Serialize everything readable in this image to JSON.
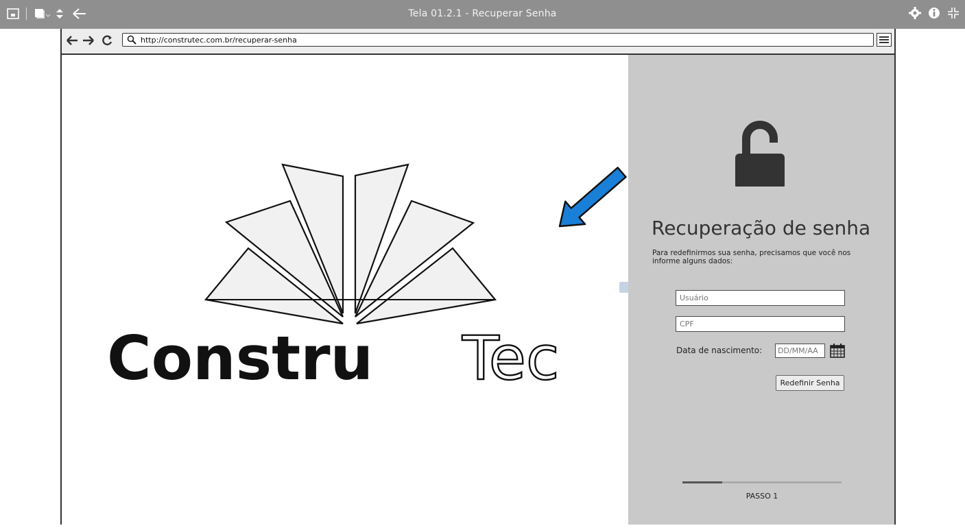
{
  "window": {
    "title": "Tela 01.2.1 - Recuperar Senha"
  },
  "browser": {
    "url": "http://construtec.com.br/recuperar-senha"
  },
  "logo": {
    "text_dark": "Constru",
    "text_light": "Tec"
  },
  "panel": {
    "heading": "Recuperação de senha",
    "description": "Para redefinirmos sua senha, precisamos que você nos informe alguns dados:",
    "username_placeholder": "Usuário",
    "cpf_placeholder": "CPF",
    "dob_label": "Data de nascimento:",
    "dob_placeholder": "DD/MM/AA",
    "submit_label": "Redefinir Senha",
    "progress_fraction": 0.25,
    "step_label": "PASSO 1"
  },
  "colors": {
    "appbar": "#8f8f8f",
    "panel": "#c9c9c9",
    "arrow": "#1a7fd6",
    "lock": "#333333"
  },
  "icons": [
    "window-icon",
    "copy-icon",
    "sort-icon",
    "back-icon",
    "gear-icon",
    "info-icon",
    "fullscreen-icon",
    "search-icon",
    "hamburger-icon",
    "unlock-icon",
    "calendar-icon",
    "arrow-annotation"
  ]
}
